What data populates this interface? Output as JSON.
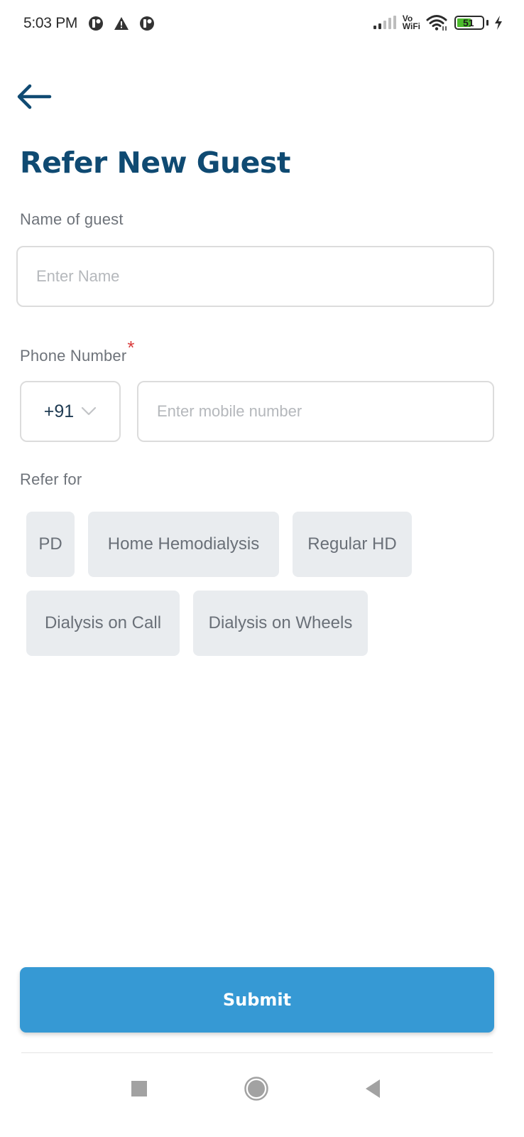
{
  "status_bar": {
    "time": "5:03 PM",
    "left_icons": [
      "notification-app-icon",
      "warning-icon",
      "notification-app-icon"
    ],
    "vowifi_line1": "Vo",
    "vowifi_line2": "WiFi",
    "battery_level": "51",
    "battery_fraction": 0.51,
    "charging": true
  },
  "header": {
    "back_icon": "arrow-left-icon",
    "title": "Refer New Guest"
  },
  "form": {
    "name": {
      "label": "Name of guest",
      "value": "",
      "placeholder": "Enter Name"
    },
    "phone": {
      "label": "Phone Number",
      "required_marker": "*",
      "country_code": "+91",
      "value": "",
      "placeholder": "Enter mobile number"
    },
    "refer_for": {
      "label": "Refer for",
      "options": [
        {
          "label": "PD",
          "selected": false
        },
        {
          "label": "Home Hemodialysis",
          "selected": false
        },
        {
          "label": "Regular HD",
          "selected": false
        },
        {
          "label": "Dialysis on Call",
          "selected": false
        },
        {
          "label": "Dialysis on Wheels",
          "selected": false
        }
      ]
    }
  },
  "actions": {
    "submit_label": "Submit"
  },
  "colors": {
    "title": "#0f4a72",
    "primary_button": "#3699d4",
    "required": "#d93b3b",
    "chip_bg": "#e9ecef",
    "battery": "#4cbb2c"
  },
  "nav_bar": {
    "buttons": [
      "recents-icon",
      "home-icon",
      "back-triangle-icon"
    ]
  }
}
